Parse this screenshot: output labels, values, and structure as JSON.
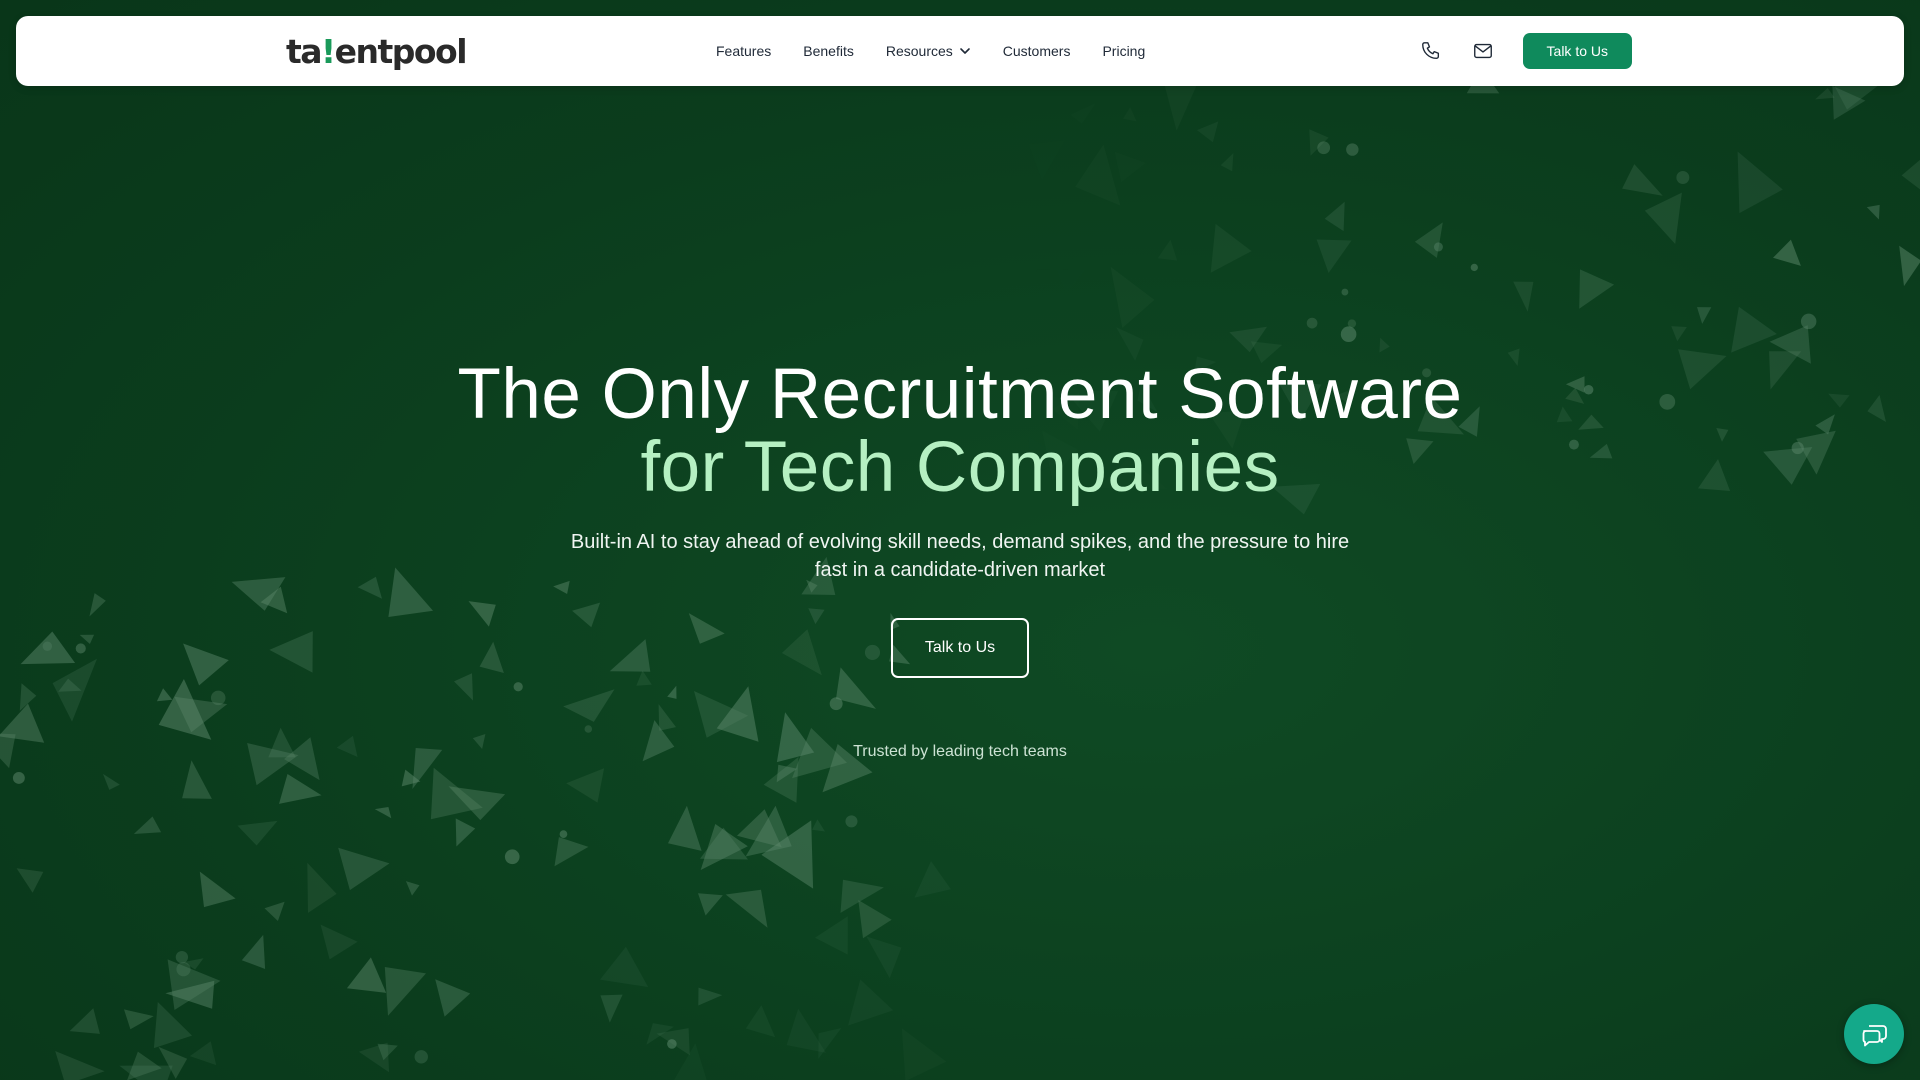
{
  "brand": {
    "logo_prefix": "ta",
    "logo_accent": "!",
    "logo_suffix": "entpool"
  },
  "nav": {
    "links": [
      {
        "label": "Features"
      },
      {
        "label": "Benefits"
      },
      {
        "label": "Resources",
        "has_dropdown": true
      },
      {
        "label": "Customers"
      },
      {
        "label": "Pricing"
      }
    ],
    "phone_icon": "phone-icon",
    "mail_icon": "mail-icon",
    "cta_label": "Talk to Us"
  },
  "hero": {
    "title_line1": "The Only Recruitment Software",
    "title_line2": "for Tech Companies",
    "subtitle": "Built-in AI to stay ahead of evolving skill needs, demand spikes, and the pressure to hire fast in a candidate-driven market",
    "cta_label": "Talk to Us",
    "trusted_text": "Trusted by leading tech teams"
  },
  "chat": {
    "icon": "chat-bubbles-icon"
  },
  "colors": {
    "background": "#0c4020",
    "accent_green": "#0f8a5c",
    "highlight_text": "#b5f0c2",
    "chat_button": "#14a98a"
  }
}
